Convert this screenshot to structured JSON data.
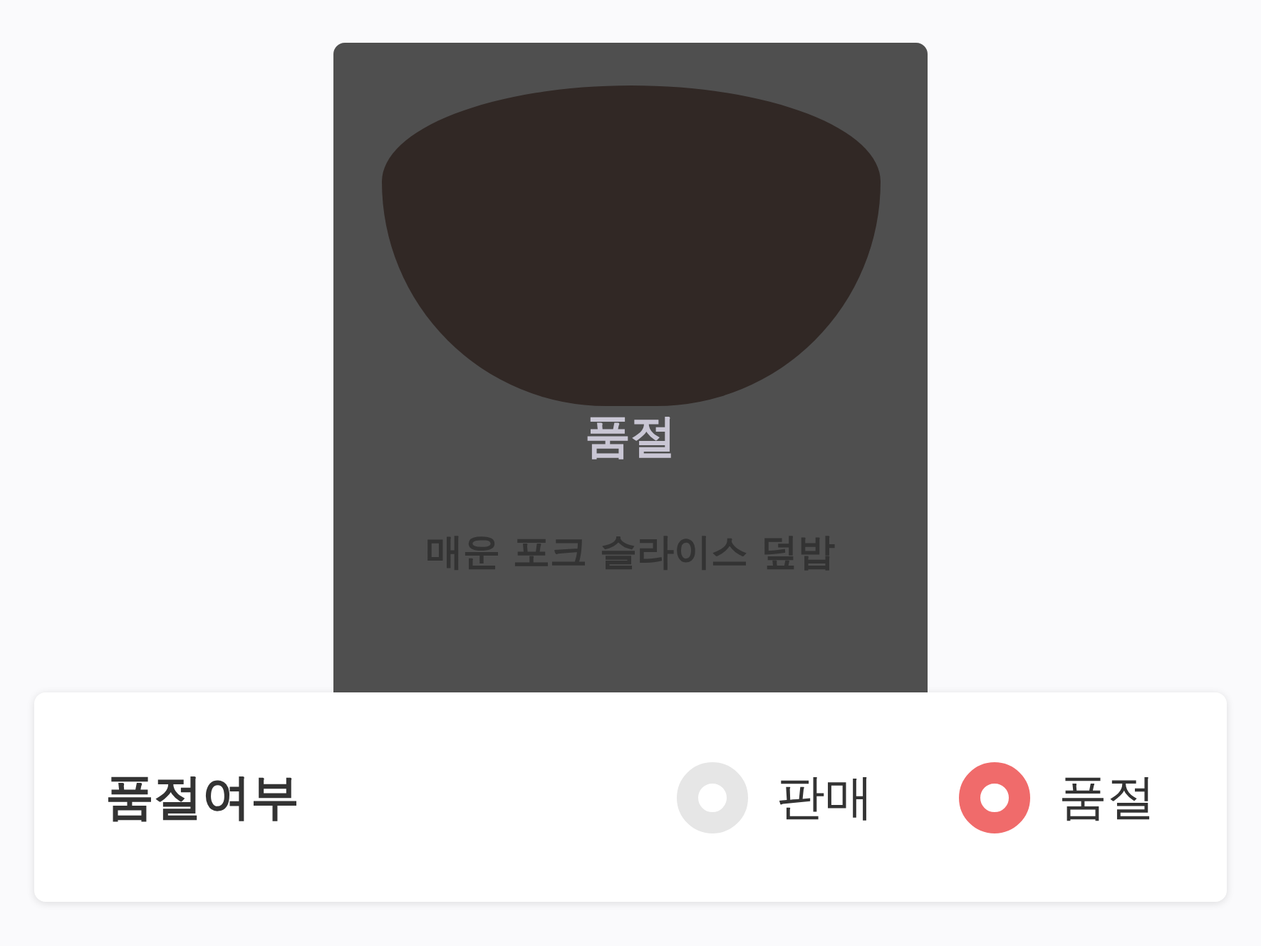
{
  "product": {
    "name": "매운 포크 슬라이스 덮밥",
    "sold_out": true,
    "sold_out_label": "품절"
  },
  "status_panel": {
    "label": "품절여부",
    "options": [
      {
        "label": "판매",
        "selected": false
      },
      {
        "label": "품절",
        "selected": true
      }
    ]
  }
}
